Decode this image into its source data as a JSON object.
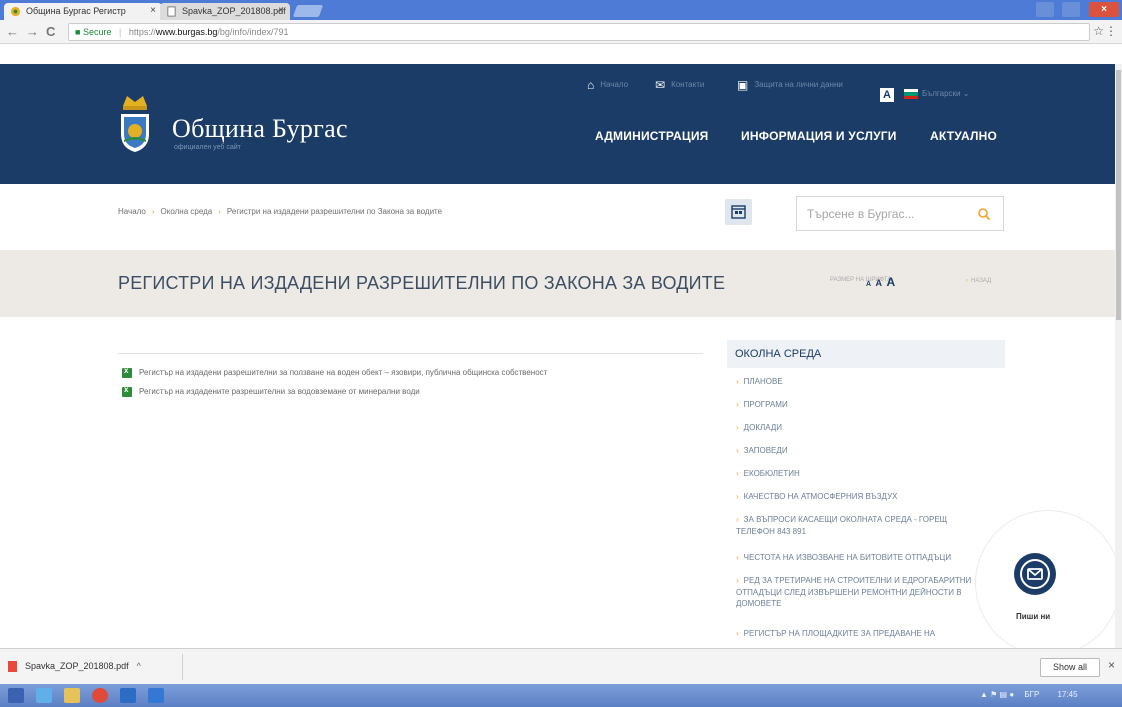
{
  "browser": {
    "tabs": [
      {
        "title": "Община Бургас Регистр"
      },
      {
        "title": "Spavka_ZOP_201808.pdf"
      }
    ],
    "tab_close": "×",
    "window_close": "×",
    "nav": {
      "back": "←",
      "forward": "→",
      "reload": "C"
    },
    "address": {
      "secure_label": "Secure",
      "separator": "|",
      "scheme": "https://",
      "host": "www.burgas.bg",
      "path": "/bg/info/index/791"
    },
    "bookmark": "☆",
    "menu": "⋮"
  },
  "site": {
    "name": "Община Бургас",
    "subtitle": "официален уеб сайт",
    "utility": [
      {
        "label": "Начало",
        "icon": "home-icon",
        "glyph": "⌂"
      },
      {
        "label": "Контакти",
        "icon": "mail-icon",
        "glyph": "✉"
      },
      {
        "label": "Защита на лични данни",
        "icon": "id-card-icon",
        "glyph": "▣"
      }
    ],
    "contrast_label": "A",
    "language": "Български ⌄",
    "main_nav": [
      "АДМИНИСТРАЦИЯ",
      "ИНФОРМАЦИЯ И УСЛУГИ",
      "АКТУАЛНО"
    ],
    "colors": {
      "header": "#1b3c66",
      "accent": "#f2a32a",
      "title_band": "#edeae6"
    }
  },
  "breadcrumb": [
    "Начало",
    "Околна среда",
    "Регистри на издадени разрешителни по Закона за водите"
  ],
  "breadcrumb_sep": "›",
  "search": {
    "placeholder": "Търсене в Бургас..."
  },
  "page": {
    "title": "РЕГИСТРИ НА ИЗДАДЕНИ РАЗРЕШИТЕЛНИ ПО ЗАКОНА ЗА ВОДИТЕ",
    "font_size_label": "РАЗМЕР НА ШРИФТА",
    "font_sizes": [
      "A",
      "A",
      "A"
    ],
    "back_arrow": "‹",
    "back_label": "НАЗАД"
  },
  "documents": [
    "Регистър на издадени разрешителни за ползване на воден обект – язовири, публична общинска собственост",
    "Регистър на издадените разрешителни за водовземане от минерални води"
  ],
  "sidebar": {
    "heading": "ОКОЛНА СРЕДА",
    "arrow": "›",
    "items": [
      "ПЛАНОВЕ",
      "ПРОГРАМИ",
      "ДОКЛАДИ",
      "ЗАПОВЕДИ",
      "ЕКОБЮЛЕТИН",
      "КАЧЕСТВО НА АТМОСФЕРНИЯ ВЪЗДУХ",
      "ЗА ВЪПРОСИ КАСАЕЩИ ОКОЛНАТА СРЕДА - ГОРЕЩ ТЕЛЕФОН 843 891",
      "ЧЕСТОТА НА ИЗВОЗВАНЕ НА БИТОВИТЕ ОТПАДЪЦИ",
      "РЕД ЗА ТРЕТИРАНЕ НА СТРОИТЕЛНИ И ЕДРОГАБАРИТНИ ОТПАДЪЦИ СЛЕД ИЗВЪРШЕНИ РЕМОНТНИ ДЕЙНОСТИ В ДОМОВЕТЕ",
      "РЕГИСТЪР НА ПЛОЩАДКИТЕ ЗА ПРЕДАВАНЕ НА"
    ]
  },
  "chat": {
    "label": "Пиши ни"
  },
  "downloads": {
    "file": "Spavka_ZOP_201808.pdf",
    "caret": "^",
    "show_all": "Show all",
    "close": "×"
  },
  "taskbar": {
    "tray_text": "БГР",
    "time": "17:45"
  }
}
